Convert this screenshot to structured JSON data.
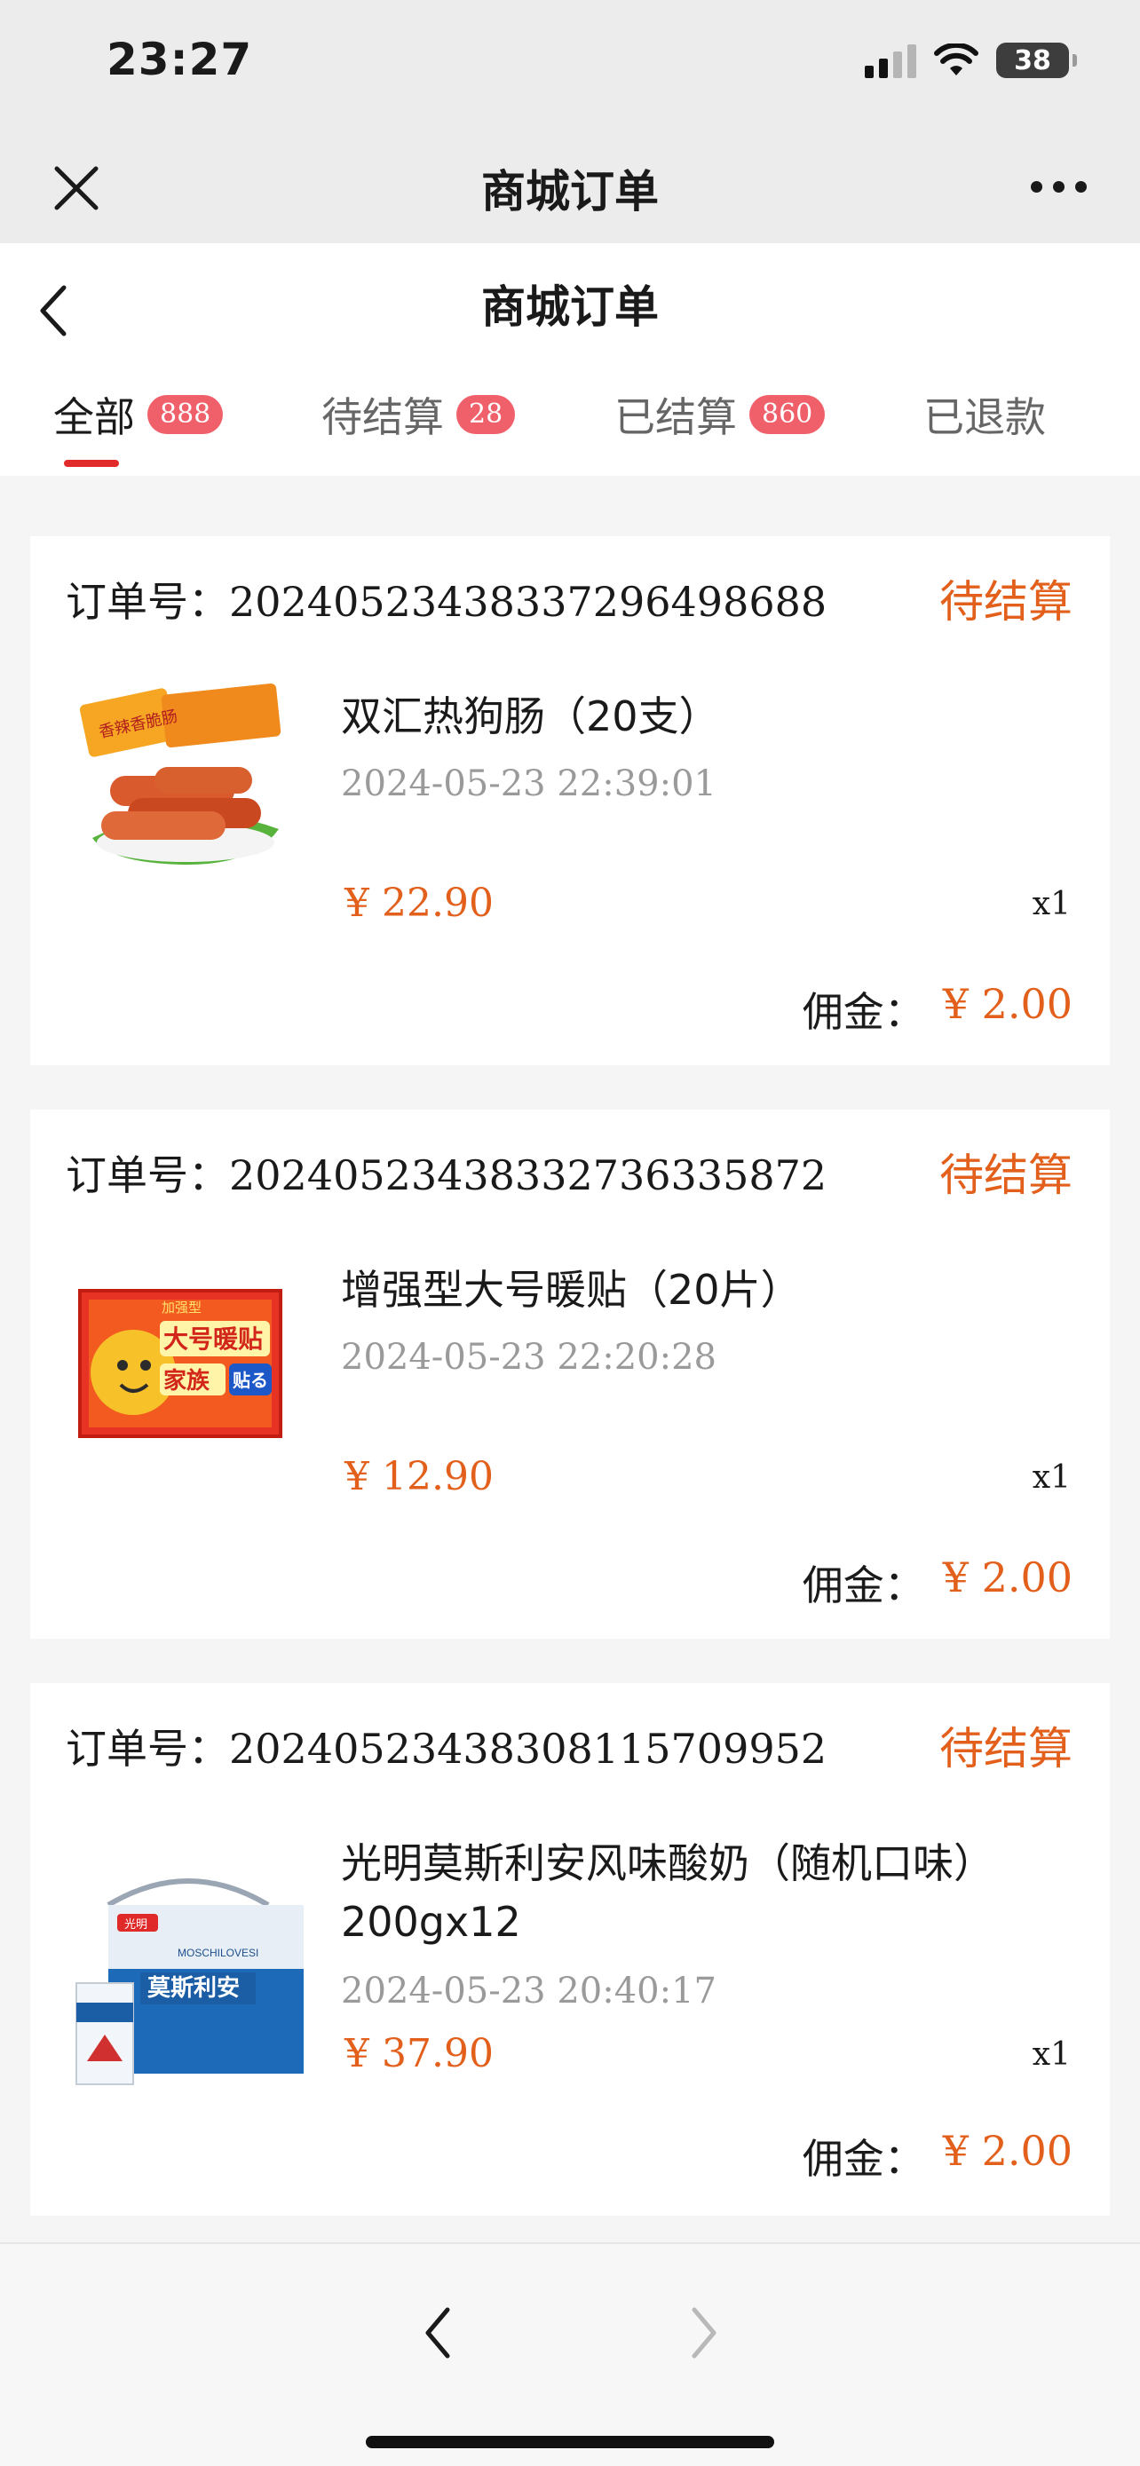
{
  "status_bar": {
    "time": "23:27",
    "battery": "38"
  },
  "mini_header": {
    "title": "商城订单",
    "close_icon": "close-icon",
    "more_icon": "more-icon"
  },
  "page_header": {
    "title": "商城订单",
    "back_icon": "chevron-left-icon"
  },
  "tabs": [
    {
      "label": "全部",
      "badge": "888",
      "active": true
    },
    {
      "label": "待结算",
      "badge": "28",
      "active": false
    },
    {
      "label": "已结算",
      "badge": "860",
      "active": false
    },
    {
      "label": "已退款",
      "badge": "",
      "active": false
    }
  ],
  "orders": [
    {
      "order_no_label": "订单号：",
      "order_no": "20240523438337296498688",
      "status": "待结算",
      "product_name": "双汇热狗肠（20支）",
      "time": "2024-05-23 22:39:01",
      "price": "¥ 22.90",
      "qty": "x1",
      "commission_label": "佣金：",
      "commission": "¥ 2.00"
    },
    {
      "order_no_label": "订单号：",
      "order_no": "20240523438332736335872",
      "status": "待结算",
      "product_name": "增强型大号暖贴（20片）",
      "time": "2024-05-23 22:20:28",
      "price": "¥ 12.90",
      "qty": "x1",
      "commission_label": "佣金：",
      "commission": "¥ 2.00"
    },
    {
      "order_no_label": "订单号：",
      "order_no": "20240523438308115709952",
      "status": "待结算",
      "product_name": "光明莫斯利安风味酸奶（随机口味）200gx12",
      "time": "2024-05-23 20:40:17",
      "price": "¥ 37.90",
      "qty": "x1",
      "commission_label": "佣金：",
      "commission": "¥ 2.00"
    }
  ],
  "product_images": {
    "sausage_label": "香辣香脆肠",
    "warmer_tag": "加强型",
    "warmer_title": "大号暖贴",
    "warmer_family": "家族",
    "warmer_stick": "贴る",
    "yogurt_brand": "莫斯利安",
    "yogurt_brand_en": "MOSCHILOVESI",
    "yogurt_logo": "光明"
  },
  "bottom_bar": {
    "back_icon": "chevron-left-icon",
    "forward_icon": "chevron-right-icon"
  },
  "colors": {
    "accent": "#e2601c",
    "badge": "#f0606a",
    "underline": "#e22a2a"
  }
}
